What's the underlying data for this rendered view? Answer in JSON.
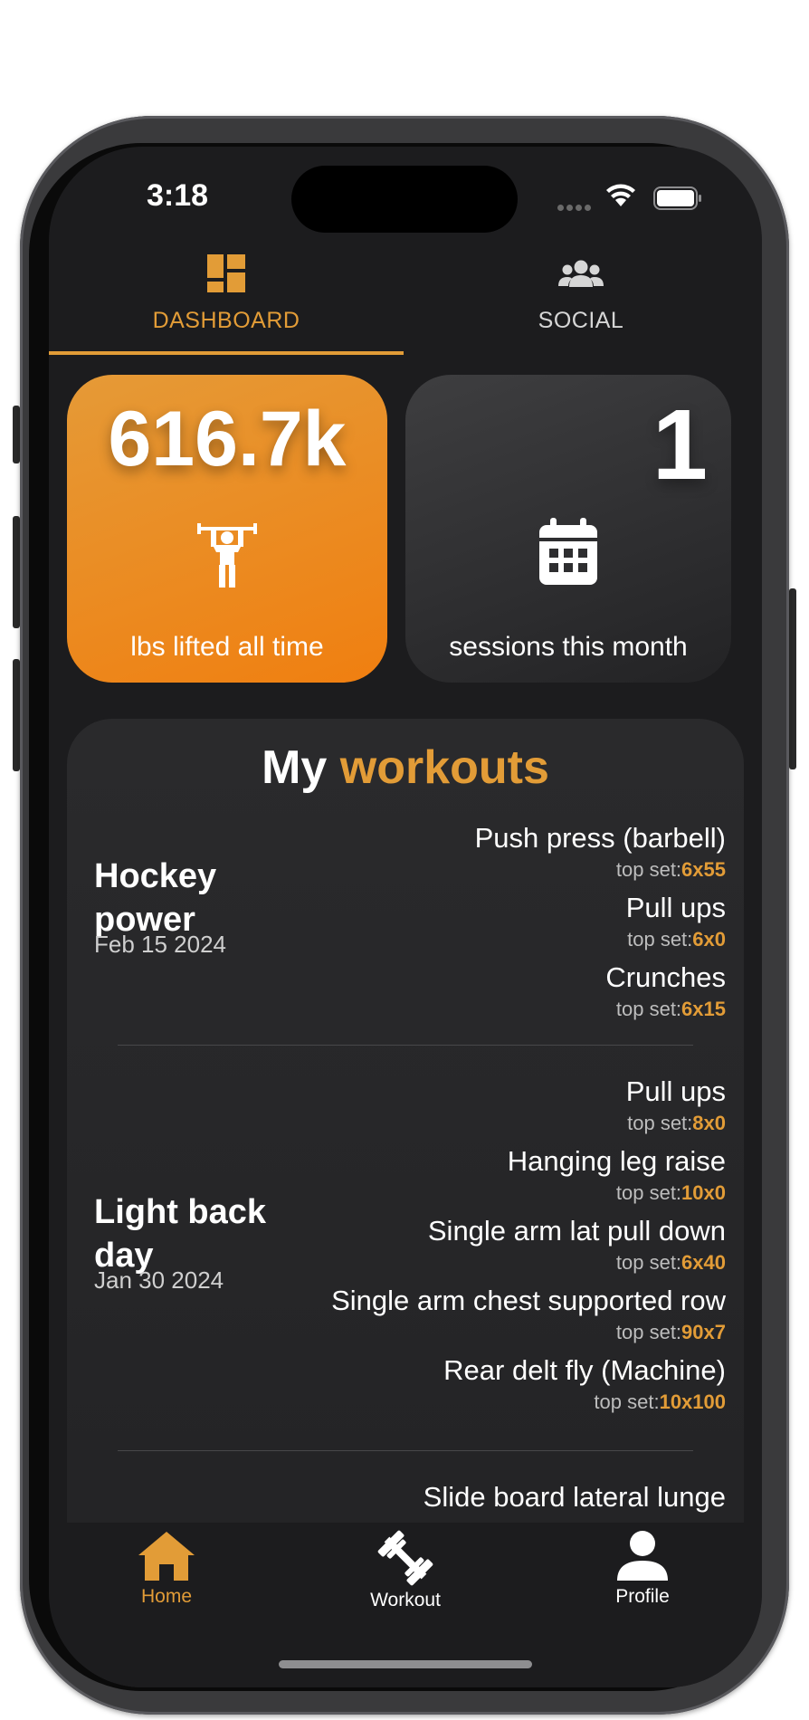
{
  "status_bar": {
    "time": "3:18"
  },
  "top_tabs": [
    {
      "label": "DASHBOARD",
      "icon": "dashboard-icon",
      "active": true
    },
    {
      "label": "SOCIAL",
      "icon": "people-icon",
      "active": false
    }
  ],
  "stats": {
    "lbs": {
      "value": "616.7k",
      "label": "lbs lifted all time",
      "icon": "weightlifter-icon"
    },
    "sessions": {
      "value": "1",
      "label": "sessions this month",
      "icon": "calendar-icon"
    }
  },
  "workouts_panel": {
    "title_prefix": "My",
    "title_accent": "workouts",
    "top_set_label": "top set:",
    "workouts": [
      {
        "name": "Hockey power",
        "date": "Feb 15 2024",
        "exercises": [
          {
            "name": "Push press (barbell)",
            "top_set": "6x55"
          },
          {
            "name": "Pull ups",
            "top_set": "6x0"
          },
          {
            "name": "Crunches",
            "top_set": "6x15"
          }
        ]
      },
      {
        "name": "Light back day",
        "date": "Jan 30 2024",
        "exercises": [
          {
            "name": "Pull ups",
            "top_set": "8x0"
          },
          {
            "name": "Hanging leg raise ",
            "top_set": "10x0"
          },
          {
            "name": "Single arm lat pull down ",
            "top_set": "6x40"
          },
          {
            "name": "Single arm chest supported row",
            "top_set": "90x7"
          },
          {
            "name": "Rear delt fly (Machine)",
            "top_set": "10x100"
          }
        ]
      },
      {
        "exercises": [
          {
            "name": "Slide board lateral lunge"
          }
        ]
      }
    ]
  },
  "bottom_nav": [
    {
      "label": "Home",
      "icon": "home-icon",
      "active": true
    },
    {
      "label": "Workout",
      "icon": "dumbbell-icon",
      "active": false
    },
    {
      "label": "Profile",
      "icon": "person-icon",
      "active": false
    }
  ],
  "colors": {
    "accent": "#e29c37",
    "background": "#1c1c1e",
    "card_orange_start": "#e59a37",
    "card_orange_end": "#f07f10",
    "text": "#ffffff"
  }
}
